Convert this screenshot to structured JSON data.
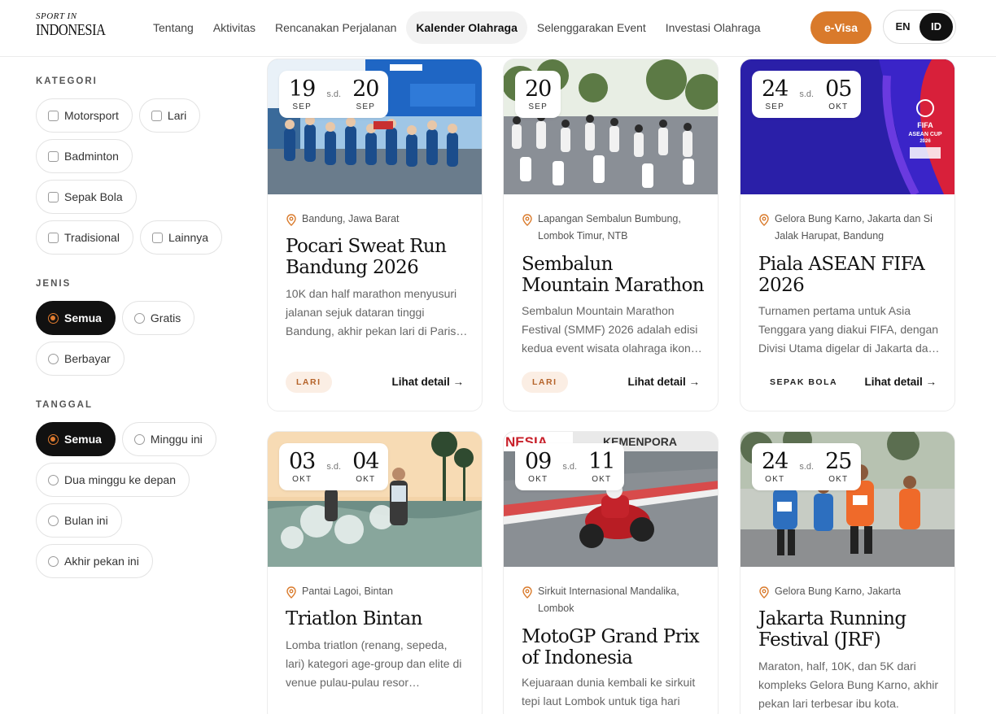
{
  "header": {
    "logo_line1": "SPORT IN",
    "logo_line2": "INDONESIA",
    "nav": [
      "Tentang",
      "Aktivitas",
      "Rencanakan Perjalanan",
      "Kalender Olahraga",
      "Selenggarakan Event",
      "Investasi Olahraga"
    ],
    "active_nav": "Kalender Olahraga",
    "evisa": "e-Visa",
    "lang_en": "EN",
    "lang_id": "ID",
    "active_lang": "ID"
  },
  "sidebar": {
    "kategori_title": "KATEGORI",
    "kategori": [
      "Motorsport",
      "Lari",
      "Badminton",
      "Sepak Bola",
      "Tradisional",
      "Lainnya"
    ],
    "jenis_title": "JENIS",
    "jenis": [
      "Semua",
      "Gratis",
      "Berbayar"
    ],
    "jenis_selected": "Semua",
    "tanggal_title": "TANGGAL",
    "tanggal": [
      "Semua",
      "Minggu ini",
      "Dua minggu ke depan",
      "Bulan ini",
      "Akhir pekan ini"
    ],
    "tanggal_selected": "Semua"
  },
  "separator": "s.d.",
  "more_label": "Lihat detail →",
  "events": [
    {
      "start_day": "19",
      "start_month": "SEP",
      "end_day": "20",
      "end_month": "SEP",
      "location": "Bandung, Jawa Barat",
      "title": "Pocari Sweat Run Bandung 2026",
      "desc": "10K dan half marathon menyusuri jalanan sejuk dataran tinggi Bandung, akhir pekan lari di Paris…",
      "tag": "LARI"
    },
    {
      "start_day": "20",
      "start_month": "SEP",
      "location": "Lapangan Sembalun Bumbung, Lombok Timur, NTB",
      "title": "Sembalun Mountain Marathon",
      "desc": "Sembalun Mountain Marathon Festival (SMMF) 2026 adalah edisi kedua event wisata olahraga ikon…",
      "tag": "LARI"
    },
    {
      "start_day": "24",
      "start_month": "SEP",
      "end_day": "05",
      "end_month": "OKT",
      "location": "Gelora Bung Karno, Jakarta dan Si Jalak Harupat, Bandung",
      "title": "Piala ASEAN FIFA 2026",
      "desc": "Turnamen pertama untuk Asia Tenggara yang diakui FIFA, dengan Divisi Utama digelar di Jakarta da…",
      "tag": "SEPAK BOLA",
      "image_text": [
        "FIFA",
        "ASEAN CUP",
        "2026"
      ]
    },
    {
      "start_day": "03",
      "start_month": "OKT",
      "end_day": "04",
      "end_month": "OKT",
      "location": "Pantai Lagoi, Bintan",
      "title": "Triatlon Bintan",
      "desc": "Lomba triatlon (renang, sepeda, lari) kategori age-group dan elite di venue pulau-pulau resor…"
    },
    {
      "start_day": "09",
      "start_month": "OKT",
      "end_day": "11",
      "end_month": "OKT",
      "location": "Sirkuit Internasional Mandalika, Lombok",
      "title": "MotoGP Grand Prix of Indonesia",
      "desc": "Kejuaraan dunia kembali ke sirkuit tepi laut Lombok untuk tiga hari",
      "image_text": [
        "NESIA",
        "KEMENPORA"
      ]
    },
    {
      "start_day": "24",
      "start_month": "OKT",
      "end_day": "25",
      "end_month": "OKT",
      "location": "Gelora Bung Karno, Jakarta",
      "title": "Jakarta Running Festival (JRF)",
      "desc": "Maraton, half, 10K, dan 5K dari kompleks Gelora Bung Karno, akhir pekan lari terbesar ibu kota."
    }
  ],
  "colors": {
    "accent": "#d97a2b",
    "tag_bg": "#fbeee4",
    "dark": "#111111"
  }
}
